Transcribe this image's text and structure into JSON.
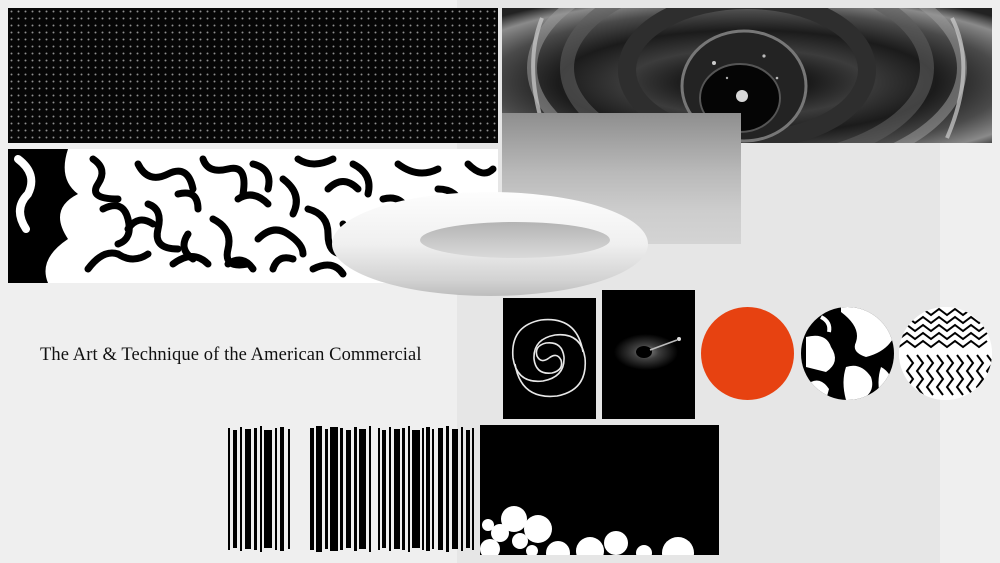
{
  "title": "The Art & Technique of the American Commercial",
  "colors": {
    "background": "#efefef",
    "panel": "#e6e6e6",
    "black": "#000000",
    "orange": "#e74211"
  },
  "images": {
    "dot_grid": "black-field-with-dot-grid",
    "pipe": "monochrome-pipe-interior-photo",
    "maze": "reaction-diffusion-pattern",
    "gradient": "grey-vertical-gradient",
    "torus": "white-3d-torus",
    "swirl": "white-spiral-on-black",
    "splash": "ink-splash-on-black",
    "orange_circle": "orange-disc",
    "blob_circle": "black-white-blob-disc",
    "zigzag_circle": "zigzag-pattern-disc",
    "barcode": "barcode-stripes",
    "bubbles": "white-bubbles-on-black"
  }
}
